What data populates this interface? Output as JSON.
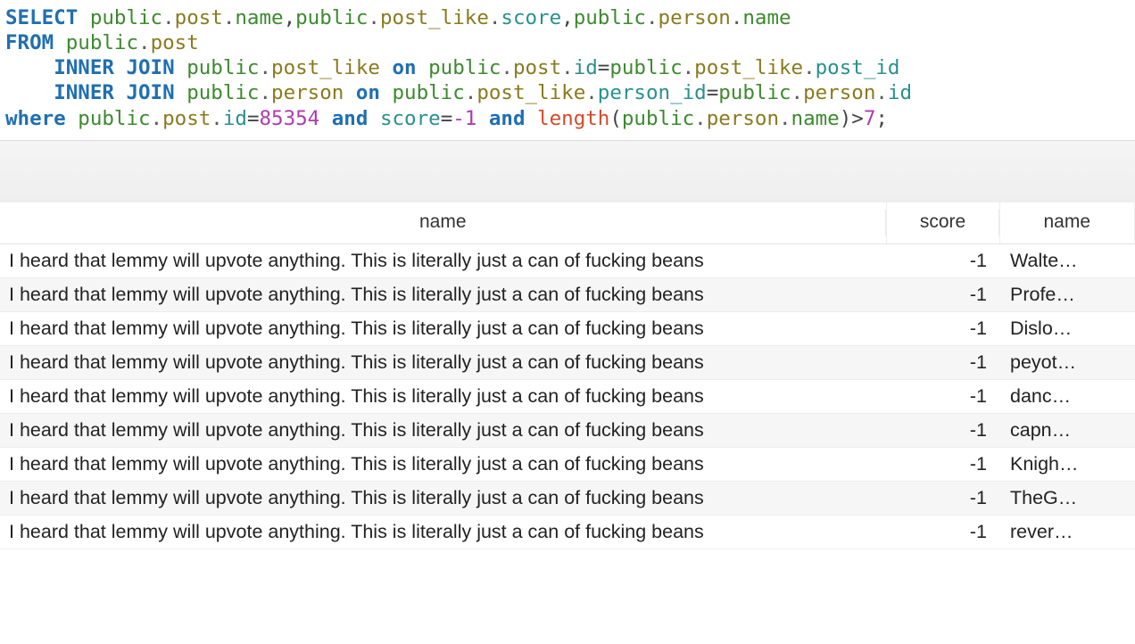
{
  "sql": {
    "l1": {
      "select": "SELECT",
      "a1": "public",
      "d1": ".",
      "a2": "post",
      "d2": ".",
      "a3": "name",
      "c1": ",",
      "b1": "public",
      "d3": ".",
      "b2": "post_like",
      "d4": ".",
      "b3": "score",
      "c2": ",",
      "e1": "public",
      "d5": ".",
      "e2": "person",
      "d6": ".",
      "e3": "name"
    },
    "l2": {
      "from": "FROM",
      "a1": "public",
      "d1": ".",
      "a2": "post"
    },
    "l3": {
      "indent": "    ",
      "ij": "INNER JOIN",
      "a1": "public",
      "d1": ".",
      "a2": "post_like",
      "on": "on",
      "b1": "public",
      "d2": ".",
      "b2": "post",
      "d3": ".",
      "b3": "id",
      "eq": "=",
      "c1": "public",
      "d4": ".",
      "c2": "post_like",
      "d5": ".",
      "c3": "post_id"
    },
    "l4": {
      "indent": "    ",
      "ij": "INNER JOIN",
      "a1": "public",
      "d1": ".",
      "a2": "person",
      "on": "on",
      "b1": "public",
      "d2": ".",
      "b2": "post_like",
      "d3": ".",
      "b3": "person_id",
      "eq": "=",
      "c1": "public",
      "d4": ".",
      "c2": "person",
      "d5": ".",
      "c3": "id"
    },
    "l5": {
      "where": "where",
      "a1": "public",
      "d1": ".",
      "a2": "post",
      "d2": ".",
      "a3": "id",
      "eq1": "=",
      "n1": "85354",
      "and1": "and",
      "score": "score",
      "eq2": "=",
      "n2": "-1",
      "and2": "and",
      "fn": "length",
      "lp": "(",
      "p1": "public",
      "d3": ".",
      "p2": "person",
      "d4": ".",
      "p3": "name",
      "rp": ")",
      "gt": ">",
      "n3": "7",
      "semi": ";"
    }
  },
  "headers": {
    "name1": "name",
    "score": "score",
    "name2": "name"
  },
  "rows": [
    {
      "name": "I heard that lemmy will upvote anything. This is literally just a can of fucking beans",
      "score": "-1",
      "person": "Walte…"
    },
    {
      "name": "I heard that lemmy will upvote anything. This is literally just a can of fucking beans",
      "score": "-1",
      "person": "Profe…"
    },
    {
      "name": "I heard that lemmy will upvote anything. This is literally just a can of fucking beans",
      "score": "-1",
      "person": "Dislo…"
    },
    {
      "name": "I heard that lemmy will upvote anything. This is literally just a can of fucking beans",
      "score": "-1",
      "person": "peyot…"
    },
    {
      "name": "I heard that lemmy will upvote anything. This is literally just a can of fucking beans",
      "score": "-1",
      "person": "danc…"
    },
    {
      "name": "I heard that lemmy will upvote anything. This is literally just a can of fucking beans",
      "score": "-1",
      "person": "capn…"
    },
    {
      "name": "I heard that lemmy will upvote anything. This is literally just a can of fucking beans",
      "score": "-1",
      "person": "Knigh…"
    },
    {
      "name": "I heard that lemmy will upvote anything. This is literally just a can of fucking beans",
      "score": "-1",
      "person": "TheG…"
    },
    {
      "name": "I heard that lemmy will upvote anything. This is literally just a can of fucking beans",
      "score": "-1",
      "person": "rever…"
    }
  ]
}
